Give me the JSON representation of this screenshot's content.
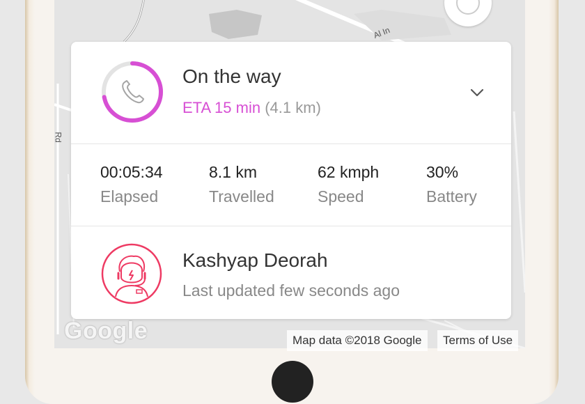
{
  "map": {
    "street_labels": [
      "Al In",
      "Rd"
    ],
    "google_logo": "Google",
    "attribution": "Map data ©2018 Google",
    "terms_link": "Terms of Use"
  },
  "status": {
    "title": "On the way",
    "eta": "ETA 15 min",
    "distance": "(4.1 km)",
    "progress_fraction": 0.72,
    "icon": "phone-icon",
    "expand_icon": "chevron-down-icon",
    "accent_color": "#d74fd4"
  },
  "stats": [
    {
      "value": "00:05:34",
      "label": "Elapsed"
    },
    {
      "value": "8.1 km",
      "label": "Travelled"
    },
    {
      "value": "62 kmph",
      "label": "Speed"
    },
    {
      "value": "30%",
      "label": "Battery"
    }
  ],
  "driver": {
    "name": "Kashyap Deorah",
    "last_updated": "Last updated few seconds ago",
    "avatar_icon": "driver-avatar-icon",
    "avatar_color": "#ee3a63"
  }
}
